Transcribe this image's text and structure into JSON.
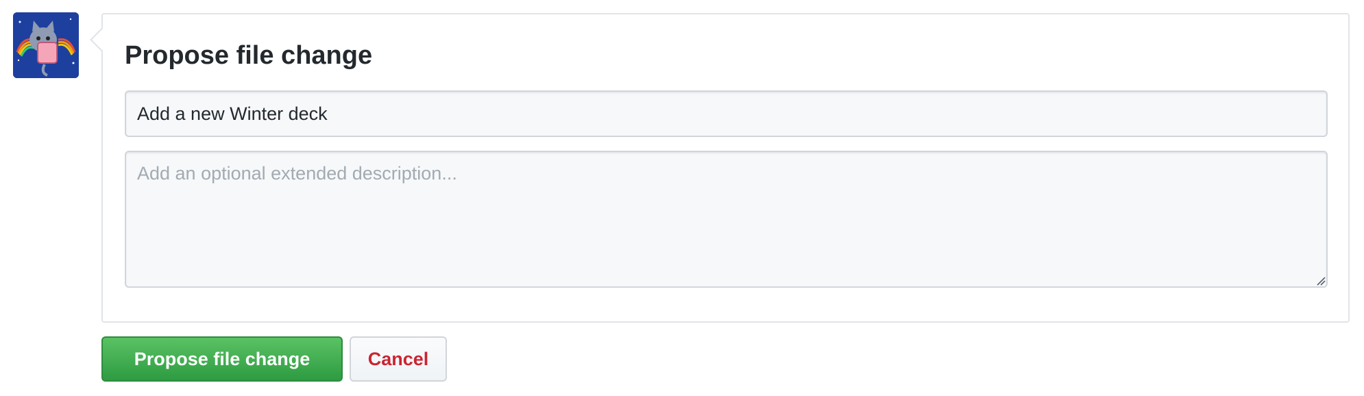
{
  "avatar": {
    "icon": "nyan-cat-avatar-icon",
    "background_color": "#1d3f9e"
  },
  "form": {
    "title": "Propose file change",
    "summary_value": "Add a new Winter deck",
    "description_placeholder": "Add an optional extended description..."
  },
  "actions": {
    "primary_label": "Propose file change",
    "cancel_label": "Cancel"
  },
  "colors": {
    "primary_button": "#2e9b42",
    "cancel_text": "#cb2431",
    "input_background": "#f6f8fa"
  }
}
